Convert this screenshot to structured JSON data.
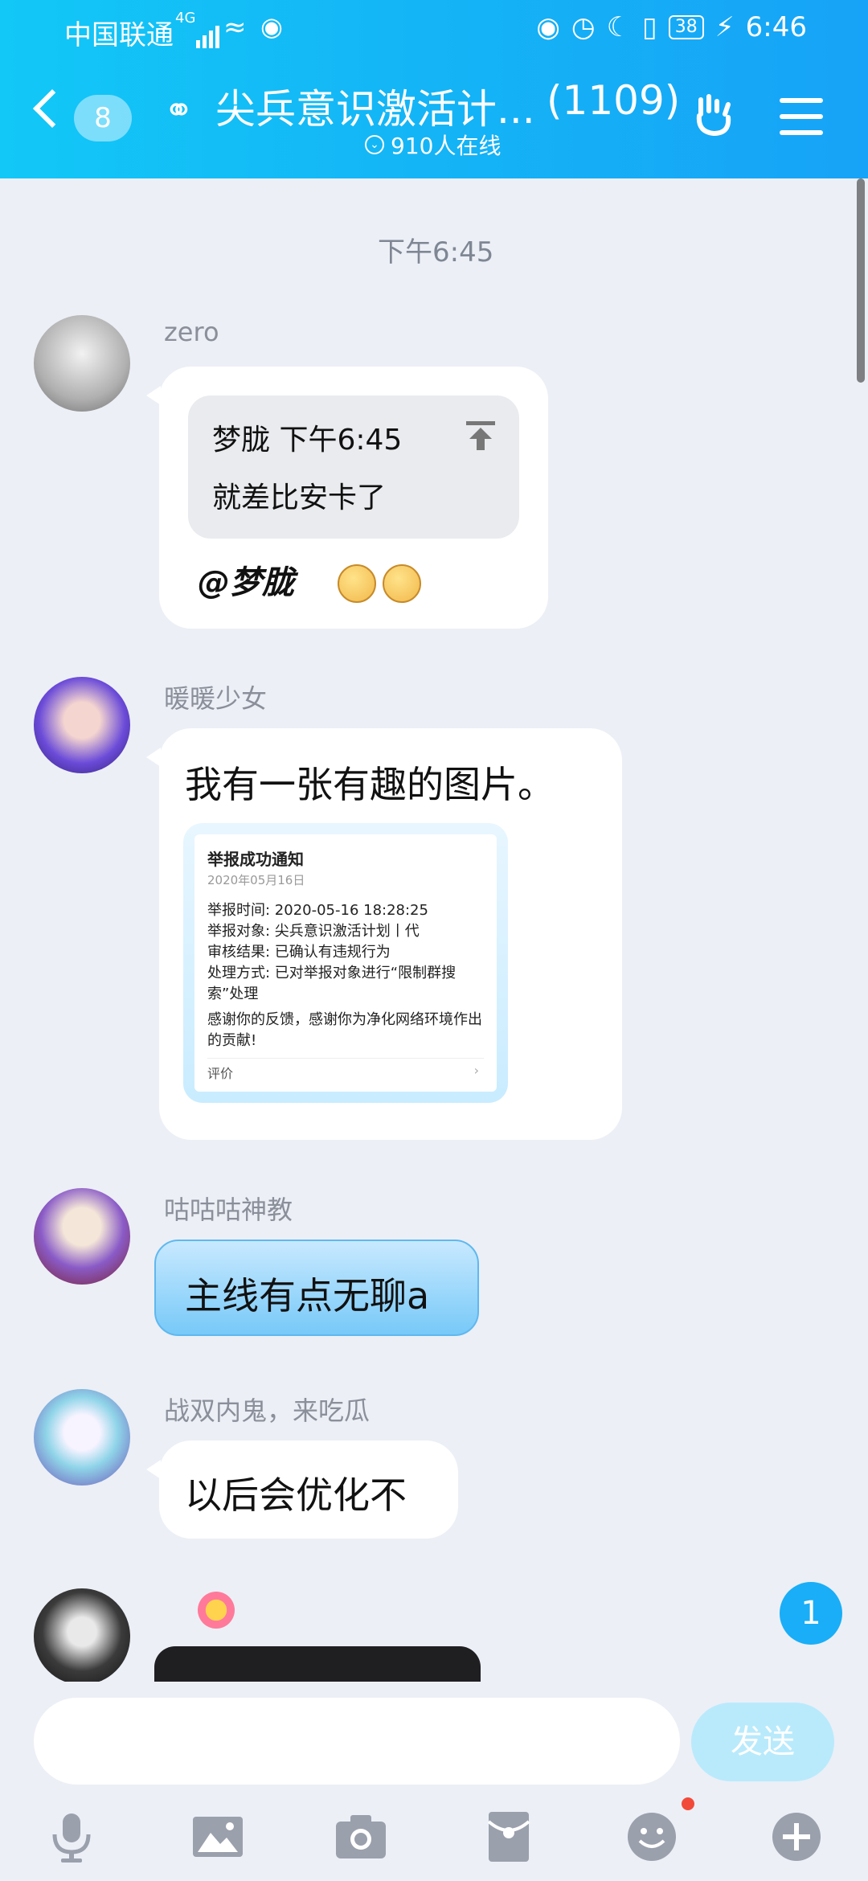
{
  "status_bar": {
    "carrier": "中国联通",
    "network": "4G",
    "battery": "38",
    "time": "6:46"
  },
  "header": {
    "back_count": "8",
    "title": "尖兵意识激活计...",
    "member_count": "(1109)",
    "online": "910人在线"
  },
  "messages": {
    "timestamp": "下午6:45",
    "m1": {
      "sender": "zero",
      "quote_author": "梦胧",
      "quote_time": "下午6:45",
      "quote_text": "就差比安卡了",
      "mention": "@梦胧"
    },
    "m2": {
      "sender": "暖暖少女",
      "text": "我有一张有趣的图片。",
      "image": {
        "title": "举报成功通知",
        "date": "2020年05月16日",
        "line1": "举报时间: 2020-05-16 18:28:25",
        "line2": "举报对象: 尖兵意识激活计划丨代",
        "line3": "审核结果: 已确认有违规行为",
        "line4": "处理方式: 已对举报对象进行“限制群搜索”处理",
        "thanks": "感谢你的反馈，感谢你为净化网络环境作出的贡献!",
        "footer": "评价"
      }
    },
    "m3": {
      "sender": "咕咕咕神教",
      "text": "主线有点无聊a"
    },
    "m4": {
      "sender": "战双内鬼，来吃瓜",
      "text": "以后会优化不"
    },
    "new_count": "1"
  },
  "input": {
    "placeholder": "",
    "send_label": "发送"
  },
  "colors": {
    "header_gradient_start": "#12c8f7",
    "header_gradient_end": "#17a3f7",
    "background": "#eceff6",
    "send_button": "#b9eafc",
    "badge": "#19aef7"
  }
}
